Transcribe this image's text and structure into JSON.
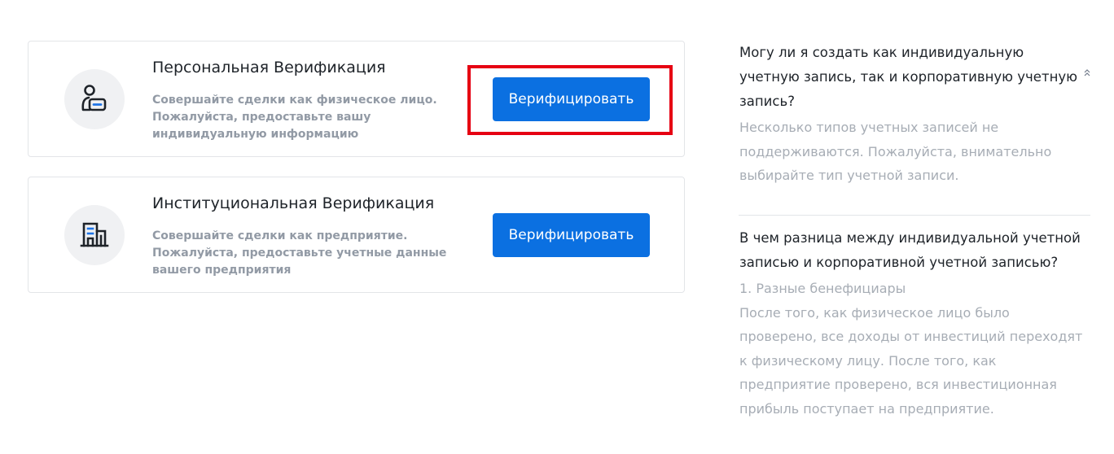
{
  "cards": [
    {
      "title": "Персональная Верификация",
      "desc_lines": [
        "Совершайте сделки как физическое лицо.",
        "Пожалуйста, предоставьте вашу",
        "индивидуальную информацию"
      ],
      "button_label": "Верифицировать",
      "icon": "person-id-icon"
    },
    {
      "title": "Институциональная Верификация",
      "desc_lines": [
        "Совершайте сделки как предприятие.",
        "Пожалуйста, предоставьте учетные данные",
        "вашего предприятия"
      ],
      "button_label": "Верифицировать",
      "icon": "building-icon"
    }
  ],
  "faq": [
    {
      "question_lines": [
        "Могу ли я создать как индивидуальную",
        "учетную запись, так и корпоративную учетную",
        "запись?"
      ],
      "answer_lines": [
        "Несколько типов учетных записей не",
        "поддерживаются. Пожалуйста, внимательно",
        "выбирайте тип учетной записи."
      ],
      "expanded": true
    },
    {
      "question_lines": [
        "В чем разница между индивидуальной учетной",
        "записью и корпоративной учетной записью?"
      ],
      "answer_lines": [
        "1. Разные бенефициары",
        "После того, как физическое лицо было",
        "проверено, все доходы от инвестиций переходят",
        "к физическому лицу. После того, как",
        "предприятие проверено, вся инвестиционная",
        "прибыль поступает на предприятие."
      ]
    }
  ],
  "colors": {
    "accent": "#0b70e1",
    "highlight": "#e60012",
    "muted_text": "#929aa5"
  }
}
